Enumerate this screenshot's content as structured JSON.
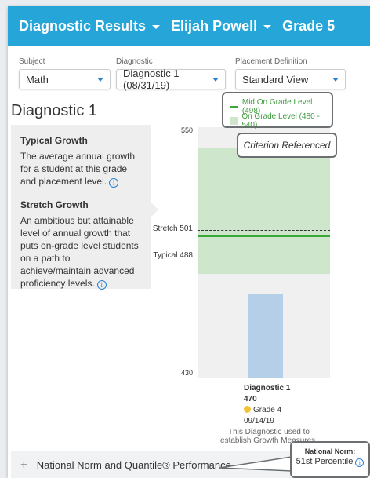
{
  "header": {
    "subject_crumb": "Diagnostic Results",
    "student_crumb": "Elijah Powell",
    "grade_crumb": "Grade 5"
  },
  "selectors": {
    "subject_label": "Subject",
    "subject_value": "Math",
    "diagnostic_label": "Diagnostic",
    "diagnostic_value": "Diagnostic 1 (08/31/19)",
    "placement_label": "Placement Definition",
    "placement_value": "Standard View"
  },
  "page_title": "Diagnostic 1",
  "info": {
    "typical_heading": "Typical Growth",
    "typical_text": "The average annual growth for a student at this grade and placement level.",
    "stretch_heading": "Stretch Growth",
    "stretch_text": "An ambitious but attainable level of annual growth that puts on-grade level students on a path to achieve/maintain advanced proficiency levels.",
    "info_icon": "i"
  },
  "legend": {
    "mid_label": "Mid On Grade Level (498)",
    "range_label": "On Grade Level (480 - 540)"
  },
  "criterion_label": "Criterion Referenced",
  "chart_data": {
    "type": "bar",
    "categories": [
      "Diagnostic 1"
    ],
    "values": [
      470
    ],
    "ylim": [
      430,
      550
    ],
    "y_tick_labels": [
      "550",
      "430"
    ],
    "on_grade_range": [
      480,
      540
    ],
    "mid_on_grade": 498,
    "stretch_label": "Stretch 501",
    "stretch_value": 501,
    "typical_label": "Typical 488",
    "typical_value": 488
  },
  "diagnostic": {
    "name": "Diagnostic 1",
    "score": "470",
    "placement": "Grade 4",
    "date": "09/14/19",
    "note": "This Diagnostic used to establish Growth Measures."
  },
  "norm": {
    "section_label": "National Norm and Quantile® Performance",
    "callout_label": "National Norm:",
    "callout_value": "51st Percentile"
  },
  "colors": {
    "header": "#26a5d9",
    "green_band": "#cde6cc",
    "mid_line": "#3aa93a",
    "bar": "#b6cfe9",
    "placement_dot": "#f2c232"
  }
}
